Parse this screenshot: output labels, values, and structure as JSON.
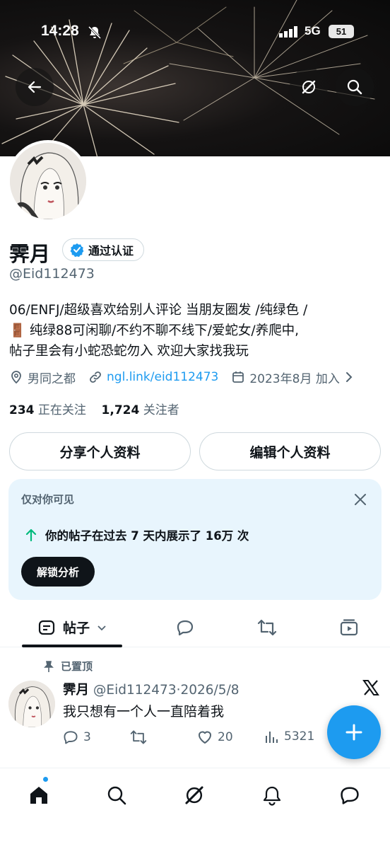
{
  "status_bar": {
    "time": "14:28",
    "network": "5G",
    "battery": "51"
  },
  "profile": {
    "name": "霁月",
    "verified_label": "通过认证",
    "handle": "@Eid112473",
    "bio_lines": [
      "06/ENFJ/超级喜欢给别人评论 当朋友圈发 /纯绿色 /",
      "🚪 纯绿88可闲聊/不约不聊不线下/爱蛇女/养爬中,",
      "帖子里会有小蛇恐蛇勿入 欢迎大家找我玩"
    ],
    "location": "男同之都",
    "link": "ngl.link/eid112473",
    "joined": "2023年8月 加入",
    "following_count": "234",
    "following_label": "正在关注",
    "followers_count": "1,724",
    "followers_label": "关注者"
  },
  "buttons": {
    "share": "分享个人资料",
    "edit": "编辑个人资料"
  },
  "private_card": {
    "title": "仅对你可见",
    "stat": "你的帖子在过去 7 天内展示了 16万 次",
    "action": "解锁分析"
  },
  "tabs": [
    {
      "label": "帖子",
      "icon": "posts-icon"
    },
    {
      "label": "",
      "icon": "replies-icon"
    },
    {
      "label": "",
      "icon": "reposts-icon"
    },
    {
      "label": "",
      "icon": "media-icon"
    }
  ],
  "post": {
    "pinned_label": "已置顶",
    "author": "霁月",
    "meta": "@Eid112473·2026/5/8",
    "text": "我只想有一个人一直陪着我",
    "replies": "3",
    "reposts": "",
    "likes": "20",
    "views": "5321"
  },
  "colors": {
    "accent": "#1d9bf0",
    "card_bg": "#e8f5fd",
    "text": "#0f1419",
    "muted": "#536471"
  },
  "bottom_nav": [
    "home-icon",
    "search-icon",
    "grok-icon",
    "notifications-icon",
    "messages-icon"
  ]
}
